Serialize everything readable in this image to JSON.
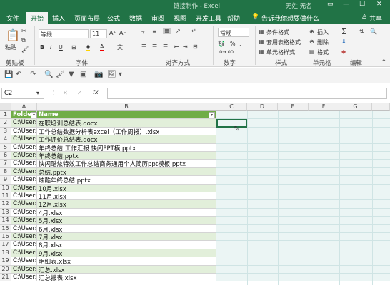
{
  "title": {
    "text": "链接制作 - Excel",
    "user": "无姓 无名"
  },
  "tabs": [
    "文件",
    "开始",
    "插入",
    "页面布局",
    "公式",
    "数据",
    "审阅",
    "视图",
    "开发工具",
    "帮助"
  ],
  "tell_me": "告诉我你想要做什么",
  "share": "共享",
  "ribbon": {
    "paste": "粘贴",
    "clipboard": "剪贴板",
    "font": "字体",
    "alignment": "对齐方式",
    "number": "数字",
    "styles": "样式",
    "cells": "单元格",
    "editing": "编辑",
    "font_name": "等线",
    "font_size": "11",
    "number_format": "常规",
    "cond_format": "条件格式",
    "table_format": "套用表格格式",
    "cell_styles": "单元格样式",
    "insert": "插入",
    "delete": "删除",
    "format": "格式"
  },
  "formula": {
    "namebox": "C2",
    "fx": "fx",
    "value": ""
  },
  "columns": [
    "A",
    "B",
    "C",
    "D",
    "E",
    "F",
    "G"
  ],
  "table_headers": [
    "Folder F",
    "Name"
  ],
  "rows": [
    {
      "n": "1"
    },
    {
      "n": "2",
      "a": "C:\\Users\\Pr",
      "b": "在职培训总结表.docx"
    },
    {
      "n": "3",
      "a": "C:\\Users\\Pr",
      "b": "工作总结数据分析表excel（工作周报）.xlsx"
    },
    {
      "n": "4",
      "a": "C:\\Users\\Pr",
      "b": "工作评价总结表.docx"
    },
    {
      "n": "5",
      "a": "C:\\Users\\Pr",
      "b": "年终总结 工作汇报 快闪PPT模.pptx"
    },
    {
      "n": "6",
      "a": "C:\\Users\\Pr",
      "b": "年终总结.pptx"
    },
    {
      "n": "7",
      "a": "C:\\Users\\Pr",
      "b": "快闪酷炫特效工作总结商务通用个人简历ppt模板.pptx"
    },
    {
      "n": "8",
      "a": "C:\\Users\\Pr",
      "b": "总结.pptx"
    },
    {
      "n": "9",
      "a": "C:\\Users\\Pr",
      "b": "炫酷年终总结.pptx"
    },
    {
      "n": "10",
      "a": "C:\\Users\\Pr",
      "b": "10月.xlsx"
    },
    {
      "n": "11",
      "a": "C:\\Users\\Pr",
      "b": "11月.xlsx"
    },
    {
      "n": "12",
      "a": "C:\\Users\\Pr",
      "b": "12月.xlsx"
    },
    {
      "n": "13",
      "a": "C:\\Users\\Pr",
      "b": "4月.xlsx"
    },
    {
      "n": "14",
      "a": "C:\\Users\\Pr",
      "b": "5月.xlsx"
    },
    {
      "n": "15",
      "a": "C:\\Users\\Pr",
      "b": "6月.xlsx"
    },
    {
      "n": "16",
      "a": "C:\\Users\\Pr",
      "b": "7月.xlsx"
    },
    {
      "n": "17",
      "a": "C:\\Users\\Pr",
      "b": "8月.xlsx"
    },
    {
      "n": "18",
      "a": "C:\\Users\\Pr",
      "b": "9月.xlsx"
    },
    {
      "n": "19",
      "a": "C:\\Users\\Pr",
      "b": "明细表.xlsx"
    },
    {
      "n": "20",
      "a": "C:\\Users\\Pr",
      "b": "汇总.xlsx"
    },
    {
      "n": "21",
      "a": "C:\\Users\\Pr",
      "b": "汇总报表.xlsx"
    }
  ],
  "colors": {
    "excel_green": "#217346",
    "header_fill": "#70ad47",
    "band_fill": "#e2efda"
  }
}
